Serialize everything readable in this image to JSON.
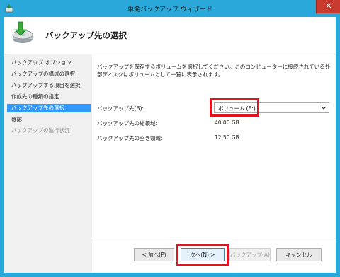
{
  "window": {
    "title": "単発バックアップ ウィザード",
    "close_glyph": "✕"
  },
  "header": {
    "title": "バックアップ先の選択",
    "icon": "backup-disk-icon"
  },
  "sidebar": {
    "items": [
      {
        "label": "バックアップ オプション",
        "state": "normal"
      },
      {
        "label": "バックアップの構成の選択",
        "state": "normal"
      },
      {
        "label": "バックアップする項目を選択",
        "state": "normal"
      },
      {
        "label": "作成先の種類の指定",
        "state": "normal"
      },
      {
        "label": "バックアップ先の選択",
        "state": "active"
      },
      {
        "label": "確認",
        "state": "normal"
      },
      {
        "label": "バックアップの進行状況",
        "state": "disabled"
      }
    ]
  },
  "main": {
    "description": "バックアップを保存するボリュームを選択してください。このコンピューターに接続されている外部ディスクはボリュームとして一覧に表示されます。",
    "destination_label": "バックアップ先(B):",
    "destination_value": "ボリューム (E:)",
    "total_label": "バックアップ先の総領域:",
    "total_value": "40.00 GB",
    "free_label": "バックアップ先の空き領域:",
    "free_value": "12.50 GB"
  },
  "buttons": {
    "back": "< 前へ(P)",
    "next": "次へ(N) >",
    "backup": "バックアップ(A)",
    "cancel": "キャンセル"
  },
  "colors": {
    "titlebar": "#2aa8d9",
    "close_button": "#c93b2f",
    "selection": "#3399ff",
    "highlight": "#e0141e"
  }
}
